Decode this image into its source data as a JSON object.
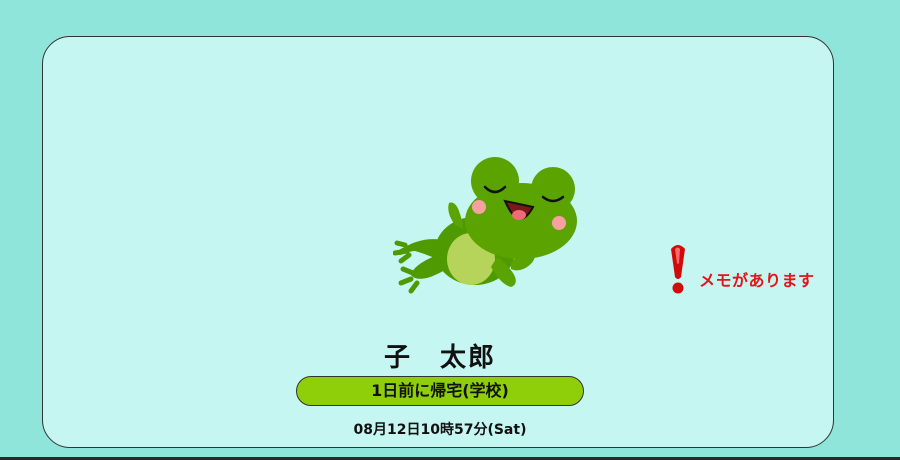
{
  "child_card": {
    "avatar_icon": "frog-icon",
    "memo": {
      "icon": "exclamation-icon",
      "text": "メモがあります"
    },
    "name": "子　太郎",
    "status": "1日前に帰宅(学校)",
    "timestamp": "08月12日10時57分(Sat)"
  },
  "colors": {
    "background": "#8fe5da",
    "card": "#c5f6f2",
    "status_badge": "#8fcf0a",
    "memo_text": "#e4141c",
    "frog_green": "#5aa300"
  }
}
